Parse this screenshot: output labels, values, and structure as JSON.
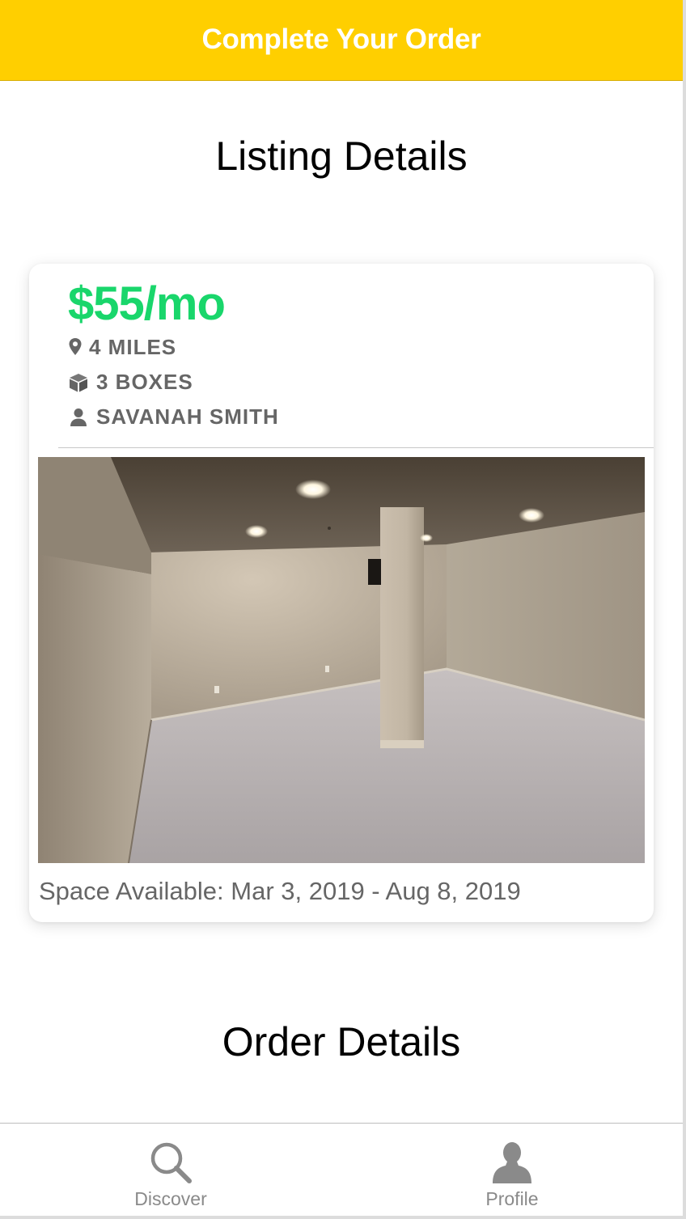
{
  "header": {
    "title": "Complete Your Order"
  },
  "listing_section": {
    "title": "Listing Details"
  },
  "listing": {
    "price": "$55/mo",
    "distance": "4 MILES",
    "boxes": "3 BOXES",
    "owner": "SAVANAH SMITH",
    "photo_icon": "basement-room-photo",
    "availability": "Space Available: Mar 3, 2019 - Aug 8, 2019"
  },
  "order_section": {
    "title": "Order Details"
  },
  "nav": {
    "items": [
      {
        "label": "Discover",
        "icon": "search-icon"
      },
      {
        "label": "Profile",
        "icon": "person-icon"
      }
    ]
  },
  "colors": {
    "header_bg": "#ffcf00",
    "price": "#19d66b",
    "meta_text": "#666666",
    "nav_text": "#8a8a8a"
  }
}
